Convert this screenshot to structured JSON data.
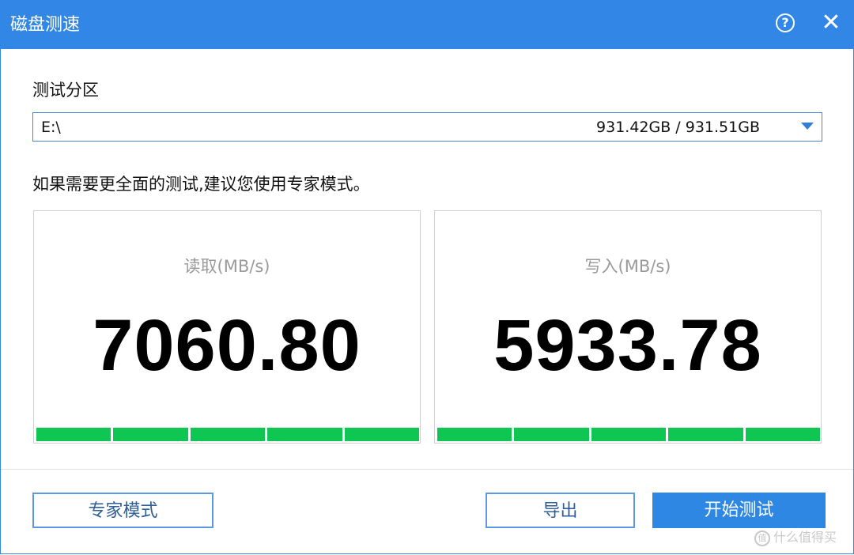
{
  "window": {
    "title": "磁盘测速",
    "help_icon": "question-circle-icon",
    "help_glyph": "?",
    "close_icon": "close-icon",
    "close_glyph": "✕"
  },
  "partition": {
    "label": "测试分区",
    "selected_drive": "E:\\",
    "size_text": "931.42GB / 931.51GB",
    "dropdown_icon": "chevron-down-icon"
  },
  "hint": "如果需要更全面的测试,建议您使用专家模式。",
  "read": {
    "caption": "读取(MB/s)",
    "value": "7060.80",
    "progress_segments_filled": 5,
    "progress_segments_total": 5
  },
  "write": {
    "caption": "写入(MB/s)",
    "value": "5933.78",
    "progress_segments_filled": 5,
    "progress_segments_total": 5
  },
  "buttons": {
    "expert_mode": "专家模式",
    "export": "导出",
    "start_test": "开始测试"
  },
  "colors": {
    "titlebar": "#3186e6",
    "progress_fill": "#0fc652",
    "primary_button": "#2d87e3"
  },
  "watermark": {
    "text": "什么值得买",
    "icon": "值"
  }
}
